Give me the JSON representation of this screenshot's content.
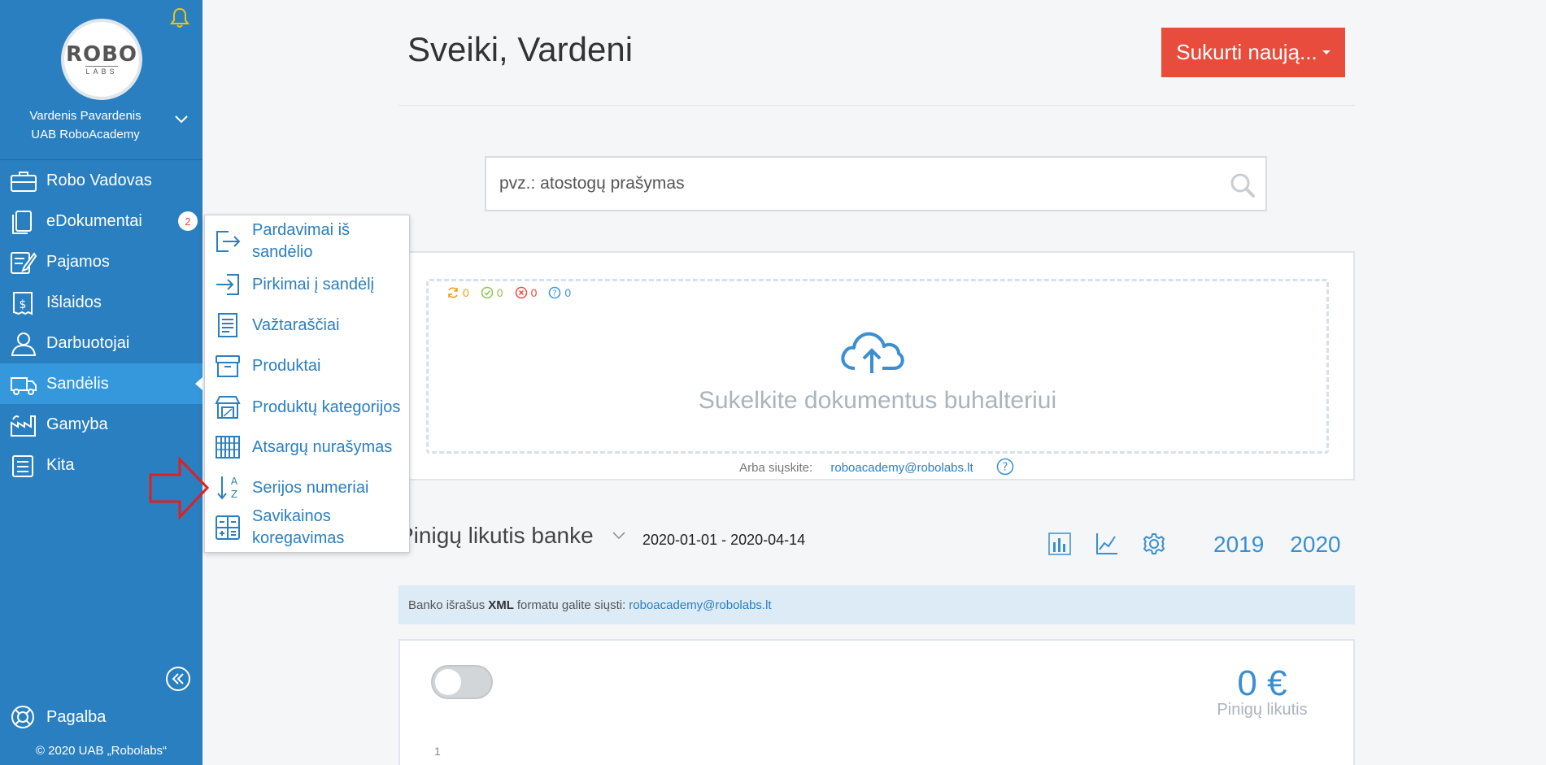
{
  "sidebar": {
    "logo": {
      "main": "ROBO",
      "sub": "LABS"
    },
    "user": {
      "name": "Vardenis Pavardenis",
      "company": "UAB RoboAcademy"
    },
    "items": [
      {
        "label": "Robo Vadovas",
        "icon": "briefcase-icon"
      },
      {
        "label": "eDokumentai",
        "icon": "documents-icon",
        "badge": "2"
      },
      {
        "label": "Pajamos",
        "icon": "edit-document-icon"
      },
      {
        "label": "Išlaidos",
        "icon": "receipt-icon"
      },
      {
        "label": "Darbuotojai",
        "icon": "person-icon"
      },
      {
        "label": "Sandėlis",
        "icon": "truck-icon",
        "active": true
      },
      {
        "label": "Gamyba",
        "icon": "factory-icon"
      },
      {
        "label": "Kita",
        "icon": "list-icon"
      }
    ],
    "help_label": "Pagalba",
    "copyright": "© 2020 UAB „Robolabs“"
  },
  "submenu": {
    "items": [
      {
        "label": "Pardavimai iš sandėlio",
        "icon": "export-icon"
      },
      {
        "label": "Pirkimai į sandėlį",
        "icon": "import-icon"
      },
      {
        "label": "Važtaraščiai",
        "icon": "waybill-icon"
      },
      {
        "label": "Produktai",
        "icon": "box-icon"
      },
      {
        "label": "Produktų kategorijos",
        "icon": "store-icon"
      },
      {
        "label": "Atsargų nurašymas",
        "icon": "abacus-icon"
      },
      {
        "label": "Serijos numeriai",
        "icon": "sort-az-icon"
      },
      {
        "label": "Savikainos koregavimas",
        "icon": "calculator-icon"
      }
    ]
  },
  "header": {
    "greeting": "Sveiki, Vardeni",
    "create_button": "Sukurti naują..."
  },
  "search": {
    "placeholder": "pvz.: atostogų prašymas"
  },
  "upload": {
    "counters": [
      {
        "icon": "sync-icon",
        "value": "0",
        "color": "#f39c12"
      },
      {
        "icon": "check-circle-icon",
        "value": "0",
        "color": "#8bc34a"
      },
      {
        "icon": "x-circle-icon",
        "value": "0",
        "color": "#e74c3c"
      },
      {
        "icon": "question-circle-icon",
        "value": "0",
        "color": "#3598dc"
      }
    ],
    "drop_text": "Sukelkite dokumentus buhalteriui",
    "email_prefix": "Arba siųskite:",
    "email": "roboacademy@robolabs.lt"
  },
  "balance": {
    "title": "Pinigų likutis banke",
    "date_range": "2020-01-01 - 2020-04-14",
    "years": [
      "2019",
      "2020"
    ],
    "info_prefix": "Banko išrašus",
    "info_format": "XML",
    "info_suffix": "formatu galite siųsti:",
    "info_email": "roboacademy@robolabs.lt",
    "amount": "0 €",
    "amount_label": "Pinigų likutis",
    "axis_tick": "1"
  },
  "colors": {
    "sidebar": "#2a7fc1",
    "active_item": "#3598dc",
    "accent_red": "#e74c3c",
    "link_blue": "#2a7fc1"
  }
}
